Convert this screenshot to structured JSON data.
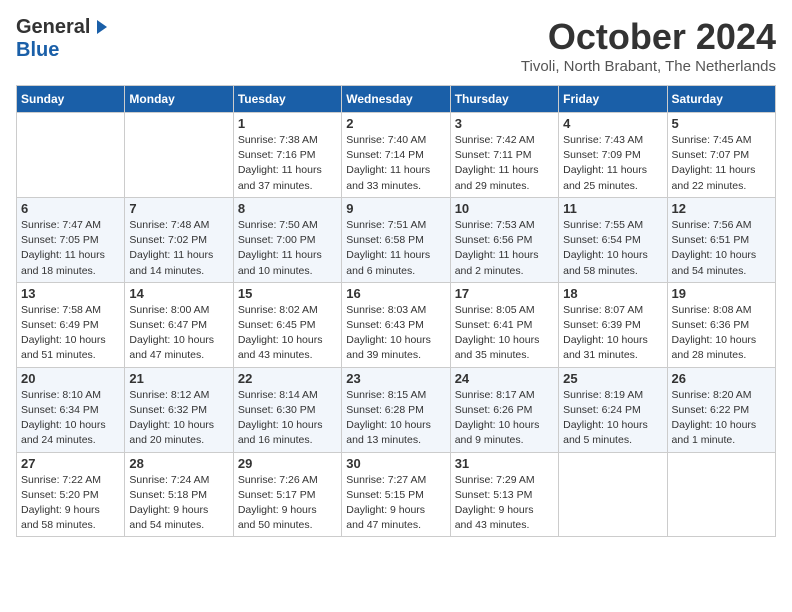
{
  "header": {
    "logo": {
      "general": "General",
      "blue": "Blue",
      "arrow": "arrow"
    },
    "title": "October 2024",
    "location": "Tivoli, North Brabant, The Netherlands"
  },
  "days_of_week": [
    "Sunday",
    "Monday",
    "Tuesday",
    "Wednesday",
    "Thursday",
    "Friday",
    "Saturday"
  ],
  "weeks": [
    [
      {
        "day": "",
        "info": ""
      },
      {
        "day": "",
        "info": ""
      },
      {
        "day": "1",
        "info": "Sunrise: 7:38 AM\nSunset: 7:16 PM\nDaylight: 11 hours\nand 37 minutes."
      },
      {
        "day": "2",
        "info": "Sunrise: 7:40 AM\nSunset: 7:14 PM\nDaylight: 11 hours\nand 33 minutes."
      },
      {
        "day": "3",
        "info": "Sunrise: 7:42 AM\nSunset: 7:11 PM\nDaylight: 11 hours\nand 29 minutes."
      },
      {
        "day": "4",
        "info": "Sunrise: 7:43 AM\nSunset: 7:09 PM\nDaylight: 11 hours\nand 25 minutes."
      },
      {
        "day": "5",
        "info": "Sunrise: 7:45 AM\nSunset: 7:07 PM\nDaylight: 11 hours\nand 22 minutes."
      }
    ],
    [
      {
        "day": "6",
        "info": "Sunrise: 7:47 AM\nSunset: 7:05 PM\nDaylight: 11 hours\nand 18 minutes."
      },
      {
        "day": "7",
        "info": "Sunrise: 7:48 AM\nSunset: 7:02 PM\nDaylight: 11 hours\nand 14 minutes."
      },
      {
        "day": "8",
        "info": "Sunrise: 7:50 AM\nSunset: 7:00 PM\nDaylight: 11 hours\nand 10 minutes."
      },
      {
        "day": "9",
        "info": "Sunrise: 7:51 AM\nSunset: 6:58 PM\nDaylight: 11 hours\nand 6 minutes."
      },
      {
        "day": "10",
        "info": "Sunrise: 7:53 AM\nSunset: 6:56 PM\nDaylight: 11 hours\nand 2 minutes."
      },
      {
        "day": "11",
        "info": "Sunrise: 7:55 AM\nSunset: 6:54 PM\nDaylight: 10 hours\nand 58 minutes."
      },
      {
        "day": "12",
        "info": "Sunrise: 7:56 AM\nSunset: 6:51 PM\nDaylight: 10 hours\nand 54 minutes."
      }
    ],
    [
      {
        "day": "13",
        "info": "Sunrise: 7:58 AM\nSunset: 6:49 PM\nDaylight: 10 hours\nand 51 minutes."
      },
      {
        "day": "14",
        "info": "Sunrise: 8:00 AM\nSunset: 6:47 PM\nDaylight: 10 hours\nand 47 minutes."
      },
      {
        "day": "15",
        "info": "Sunrise: 8:02 AM\nSunset: 6:45 PM\nDaylight: 10 hours\nand 43 minutes."
      },
      {
        "day": "16",
        "info": "Sunrise: 8:03 AM\nSunset: 6:43 PM\nDaylight: 10 hours\nand 39 minutes."
      },
      {
        "day": "17",
        "info": "Sunrise: 8:05 AM\nSunset: 6:41 PM\nDaylight: 10 hours\nand 35 minutes."
      },
      {
        "day": "18",
        "info": "Sunrise: 8:07 AM\nSunset: 6:39 PM\nDaylight: 10 hours\nand 31 minutes."
      },
      {
        "day": "19",
        "info": "Sunrise: 8:08 AM\nSunset: 6:36 PM\nDaylight: 10 hours\nand 28 minutes."
      }
    ],
    [
      {
        "day": "20",
        "info": "Sunrise: 8:10 AM\nSunset: 6:34 PM\nDaylight: 10 hours\nand 24 minutes."
      },
      {
        "day": "21",
        "info": "Sunrise: 8:12 AM\nSunset: 6:32 PM\nDaylight: 10 hours\nand 20 minutes."
      },
      {
        "day": "22",
        "info": "Sunrise: 8:14 AM\nSunset: 6:30 PM\nDaylight: 10 hours\nand 16 minutes."
      },
      {
        "day": "23",
        "info": "Sunrise: 8:15 AM\nSunset: 6:28 PM\nDaylight: 10 hours\nand 13 minutes."
      },
      {
        "day": "24",
        "info": "Sunrise: 8:17 AM\nSunset: 6:26 PM\nDaylight: 10 hours\nand 9 minutes."
      },
      {
        "day": "25",
        "info": "Sunrise: 8:19 AM\nSunset: 6:24 PM\nDaylight: 10 hours\nand 5 minutes."
      },
      {
        "day": "26",
        "info": "Sunrise: 8:20 AM\nSunset: 6:22 PM\nDaylight: 10 hours\nand 1 minute."
      }
    ],
    [
      {
        "day": "27",
        "info": "Sunrise: 7:22 AM\nSunset: 5:20 PM\nDaylight: 9 hours\nand 58 minutes."
      },
      {
        "day": "28",
        "info": "Sunrise: 7:24 AM\nSunset: 5:18 PM\nDaylight: 9 hours\nand 54 minutes."
      },
      {
        "day": "29",
        "info": "Sunrise: 7:26 AM\nSunset: 5:17 PM\nDaylight: 9 hours\nand 50 minutes."
      },
      {
        "day": "30",
        "info": "Sunrise: 7:27 AM\nSunset: 5:15 PM\nDaylight: 9 hours\nand 47 minutes."
      },
      {
        "day": "31",
        "info": "Sunrise: 7:29 AM\nSunset: 5:13 PM\nDaylight: 9 hours\nand 43 minutes."
      },
      {
        "day": "",
        "info": ""
      },
      {
        "day": "",
        "info": ""
      }
    ]
  ]
}
